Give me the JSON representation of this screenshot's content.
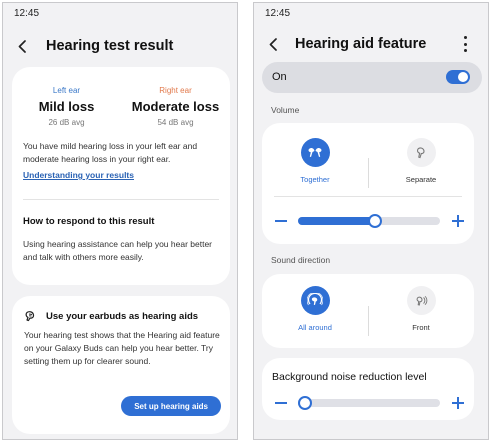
{
  "left_screen": {
    "status_time": "12:45",
    "title": "Hearing test result",
    "left_ear": {
      "label": "Left ear",
      "result": "Mild loss",
      "avg": "26 dB avg"
    },
    "right_ear": {
      "label": "Right ear",
      "result": "Moderate loss",
      "avg": "54 dB avg"
    },
    "description": "You have mild hearing loss in your left ear and moderate hearing loss in your right ear.",
    "link_text": "Understanding your results",
    "respond_title": "How to respond to this result",
    "respond_body": "Using hearing assistance can help you hear better and talk with others more easily.",
    "earbuds_title": "Use your earbuds as hearing aids",
    "earbuds_body": "Your hearing test shows that the Hearing aid feature on your Galaxy Buds can help you hear better. Try setting them up for clearer sound.",
    "setup_button": "Set up hearing aids"
  },
  "right_screen": {
    "status_time": "12:45",
    "title": "Hearing aid feature",
    "master_toggle": {
      "label": "On",
      "on": true
    },
    "volume_section": "Volume",
    "volume_options": [
      {
        "label": "Together",
        "icon": "together-earbuds-icon",
        "selected": true
      },
      {
        "label": "Separate",
        "icon": "separate-earbuds-icon",
        "selected": false
      }
    ],
    "volume_level": 0.54,
    "sound_direction_section": "Sound direction",
    "direction_options": [
      {
        "label": "All around",
        "icon": "all-around-icon",
        "selected": true
      },
      {
        "label": "Front",
        "icon": "front-icon",
        "selected": false
      }
    ],
    "noise_reduction_title": "Background noise reduction level",
    "noise_level": 0.0
  },
  "colors": {
    "accent": "#2f6fd4",
    "left_ear": "#3a78c8",
    "right_ear": "#e1784a",
    "background": "#f2f2f4",
    "card": "#ffffff"
  }
}
